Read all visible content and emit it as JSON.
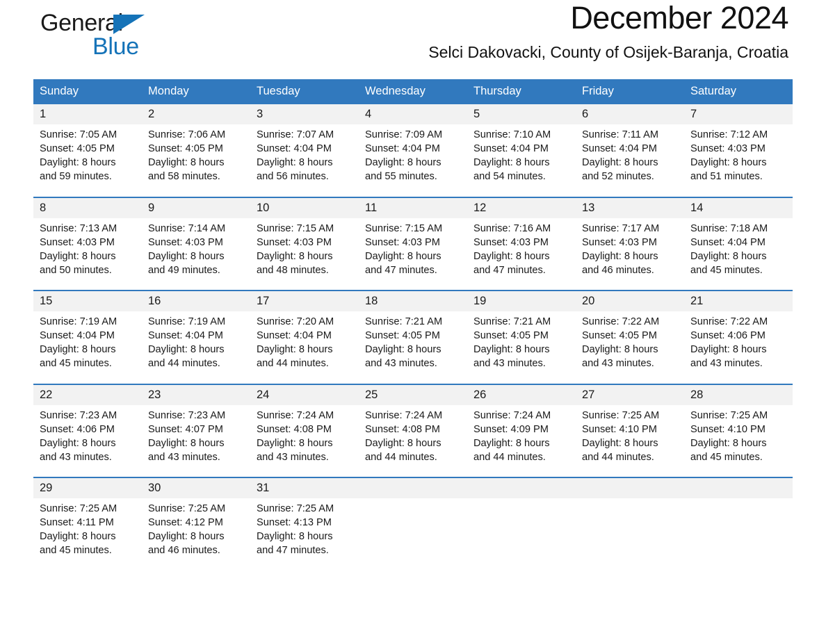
{
  "brand": {
    "name_part1": "General",
    "name_part2": "Blue",
    "triangle_color": "#1573b8",
    "accent_color": "#3179be"
  },
  "header": {
    "title": "December 2024",
    "subtitle": "Selci Dakovacki, County of Osijek-Baranja, Croatia"
  },
  "calendar": {
    "weekday_headers": [
      "Sunday",
      "Monday",
      "Tuesday",
      "Wednesday",
      "Thursday",
      "Friday",
      "Saturday"
    ],
    "weeks": [
      {
        "days": [
          {
            "num": "1",
            "sunrise": "Sunrise: 7:05 AM",
            "sunset": "Sunset: 4:05 PM",
            "daylight1": "Daylight: 8 hours",
            "daylight2": "and 59 minutes."
          },
          {
            "num": "2",
            "sunrise": "Sunrise: 7:06 AM",
            "sunset": "Sunset: 4:05 PM",
            "daylight1": "Daylight: 8 hours",
            "daylight2": "and 58 minutes."
          },
          {
            "num": "3",
            "sunrise": "Sunrise: 7:07 AM",
            "sunset": "Sunset: 4:04 PM",
            "daylight1": "Daylight: 8 hours",
            "daylight2": "and 56 minutes."
          },
          {
            "num": "4",
            "sunrise": "Sunrise: 7:09 AM",
            "sunset": "Sunset: 4:04 PM",
            "daylight1": "Daylight: 8 hours",
            "daylight2": "and 55 minutes."
          },
          {
            "num": "5",
            "sunrise": "Sunrise: 7:10 AM",
            "sunset": "Sunset: 4:04 PM",
            "daylight1": "Daylight: 8 hours",
            "daylight2": "and 54 minutes."
          },
          {
            "num": "6",
            "sunrise": "Sunrise: 7:11 AM",
            "sunset": "Sunset: 4:04 PM",
            "daylight1": "Daylight: 8 hours",
            "daylight2": "and 52 minutes."
          },
          {
            "num": "7",
            "sunrise": "Sunrise: 7:12 AM",
            "sunset": "Sunset: 4:03 PM",
            "daylight1": "Daylight: 8 hours",
            "daylight2": "and 51 minutes."
          }
        ]
      },
      {
        "days": [
          {
            "num": "8",
            "sunrise": "Sunrise: 7:13 AM",
            "sunset": "Sunset: 4:03 PM",
            "daylight1": "Daylight: 8 hours",
            "daylight2": "and 50 minutes."
          },
          {
            "num": "9",
            "sunrise": "Sunrise: 7:14 AM",
            "sunset": "Sunset: 4:03 PM",
            "daylight1": "Daylight: 8 hours",
            "daylight2": "and 49 minutes."
          },
          {
            "num": "10",
            "sunrise": "Sunrise: 7:15 AM",
            "sunset": "Sunset: 4:03 PM",
            "daylight1": "Daylight: 8 hours",
            "daylight2": "and 48 minutes."
          },
          {
            "num": "11",
            "sunrise": "Sunrise: 7:15 AM",
            "sunset": "Sunset: 4:03 PM",
            "daylight1": "Daylight: 8 hours",
            "daylight2": "and 47 minutes."
          },
          {
            "num": "12",
            "sunrise": "Sunrise: 7:16 AM",
            "sunset": "Sunset: 4:03 PM",
            "daylight1": "Daylight: 8 hours",
            "daylight2": "and 47 minutes."
          },
          {
            "num": "13",
            "sunrise": "Sunrise: 7:17 AM",
            "sunset": "Sunset: 4:03 PM",
            "daylight1": "Daylight: 8 hours",
            "daylight2": "and 46 minutes."
          },
          {
            "num": "14",
            "sunrise": "Sunrise: 7:18 AM",
            "sunset": "Sunset: 4:04 PM",
            "daylight1": "Daylight: 8 hours",
            "daylight2": "and 45 minutes."
          }
        ]
      },
      {
        "days": [
          {
            "num": "15",
            "sunrise": "Sunrise: 7:19 AM",
            "sunset": "Sunset: 4:04 PM",
            "daylight1": "Daylight: 8 hours",
            "daylight2": "and 45 minutes."
          },
          {
            "num": "16",
            "sunrise": "Sunrise: 7:19 AM",
            "sunset": "Sunset: 4:04 PM",
            "daylight1": "Daylight: 8 hours",
            "daylight2": "and 44 minutes."
          },
          {
            "num": "17",
            "sunrise": "Sunrise: 7:20 AM",
            "sunset": "Sunset: 4:04 PM",
            "daylight1": "Daylight: 8 hours",
            "daylight2": "and 44 minutes."
          },
          {
            "num": "18",
            "sunrise": "Sunrise: 7:21 AM",
            "sunset": "Sunset: 4:05 PM",
            "daylight1": "Daylight: 8 hours",
            "daylight2": "and 43 minutes."
          },
          {
            "num": "19",
            "sunrise": "Sunrise: 7:21 AM",
            "sunset": "Sunset: 4:05 PM",
            "daylight1": "Daylight: 8 hours",
            "daylight2": "and 43 minutes."
          },
          {
            "num": "20",
            "sunrise": "Sunrise: 7:22 AM",
            "sunset": "Sunset: 4:05 PM",
            "daylight1": "Daylight: 8 hours",
            "daylight2": "and 43 minutes."
          },
          {
            "num": "21",
            "sunrise": "Sunrise: 7:22 AM",
            "sunset": "Sunset: 4:06 PM",
            "daylight1": "Daylight: 8 hours",
            "daylight2": "and 43 minutes."
          }
        ]
      },
      {
        "days": [
          {
            "num": "22",
            "sunrise": "Sunrise: 7:23 AM",
            "sunset": "Sunset: 4:06 PM",
            "daylight1": "Daylight: 8 hours",
            "daylight2": "and 43 minutes."
          },
          {
            "num": "23",
            "sunrise": "Sunrise: 7:23 AM",
            "sunset": "Sunset: 4:07 PM",
            "daylight1": "Daylight: 8 hours",
            "daylight2": "and 43 minutes."
          },
          {
            "num": "24",
            "sunrise": "Sunrise: 7:24 AM",
            "sunset": "Sunset: 4:08 PM",
            "daylight1": "Daylight: 8 hours",
            "daylight2": "and 43 minutes."
          },
          {
            "num": "25",
            "sunrise": "Sunrise: 7:24 AM",
            "sunset": "Sunset: 4:08 PM",
            "daylight1": "Daylight: 8 hours",
            "daylight2": "and 44 minutes."
          },
          {
            "num": "26",
            "sunrise": "Sunrise: 7:24 AM",
            "sunset": "Sunset: 4:09 PM",
            "daylight1": "Daylight: 8 hours",
            "daylight2": "and 44 minutes."
          },
          {
            "num": "27",
            "sunrise": "Sunrise: 7:25 AM",
            "sunset": "Sunset: 4:10 PM",
            "daylight1": "Daylight: 8 hours",
            "daylight2": "and 44 minutes."
          },
          {
            "num": "28",
            "sunrise": "Sunrise: 7:25 AM",
            "sunset": "Sunset: 4:10 PM",
            "daylight1": "Daylight: 8 hours",
            "daylight2": "and 45 minutes."
          }
        ]
      },
      {
        "days": [
          {
            "num": "29",
            "sunrise": "Sunrise: 7:25 AM",
            "sunset": "Sunset: 4:11 PM",
            "daylight1": "Daylight: 8 hours",
            "daylight2": "and 45 minutes."
          },
          {
            "num": "30",
            "sunrise": "Sunrise: 7:25 AM",
            "sunset": "Sunset: 4:12 PM",
            "daylight1": "Daylight: 8 hours",
            "daylight2": "and 46 minutes."
          },
          {
            "num": "31",
            "sunrise": "Sunrise: 7:25 AM",
            "sunset": "Sunset: 4:13 PM",
            "daylight1": "Daylight: 8 hours",
            "daylight2": "and 47 minutes."
          },
          {
            "num": "",
            "sunrise": "",
            "sunset": "",
            "daylight1": "",
            "daylight2": ""
          },
          {
            "num": "",
            "sunrise": "",
            "sunset": "",
            "daylight1": "",
            "daylight2": ""
          },
          {
            "num": "",
            "sunrise": "",
            "sunset": "",
            "daylight1": "",
            "daylight2": ""
          },
          {
            "num": "",
            "sunrise": "",
            "sunset": "",
            "daylight1": "",
            "daylight2": ""
          }
        ]
      }
    ]
  }
}
